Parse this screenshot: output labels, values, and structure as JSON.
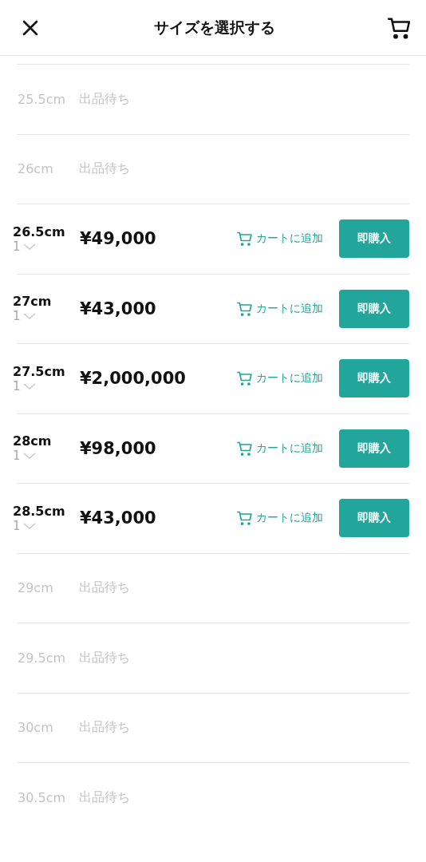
{
  "header": {
    "title": "サイズを選択する"
  },
  "sizes": [
    {
      "kind": "waiting",
      "size": "25.5cm",
      "status": "出品待ち"
    },
    {
      "kind": "waiting",
      "size": "26cm",
      "status": "出品待ち"
    },
    {
      "kind": "available",
      "size": "26.5cm",
      "quantity": "1",
      "price": "¥49,000",
      "cart": "カートに追加",
      "buy": "即購入"
    },
    {
      "kind": "available",
      "size": "27cm",
      "quantity": "1",
      "price": "¥43,000",
      "cart": "カートに追加",
      "buy": "即購入"
    },
    {
      "kind": "available",
      "size": "27.5cm",
      "quantity": "1",
      "price": "¥2,000,000",
      "cart": "カートに追加",
      "buy": "即購入"
    },
    {
      "kind": "available",
      "size": "28cm",
      "quantity": "1",
      "price": "¥98,000",
      "cart": "カートに追加",
      "buy": "即購入"
    },
    {
      "kind": "available",
      "size": "28.5cm",
      "quantity": "1",
      "price": "¥43,000",
      "cart": "カートに追加",
      "buy": "即購入"
    },
    {
      "kind": "waiting",
      "size": "29cm",
      "status": "出品待ち"
    },
    {
      "kind": "waiting",
      "size": "29.5cm",
      "status": "出品待ち"
    },
    {
      "kind": "waiting",
      "size": "30cm",
      "status": "出品待ち"
    },
    {
      "kind": "waiting",
      "size": "30.5cm",
      "status": "出品待ち"
    }
  ]
}
